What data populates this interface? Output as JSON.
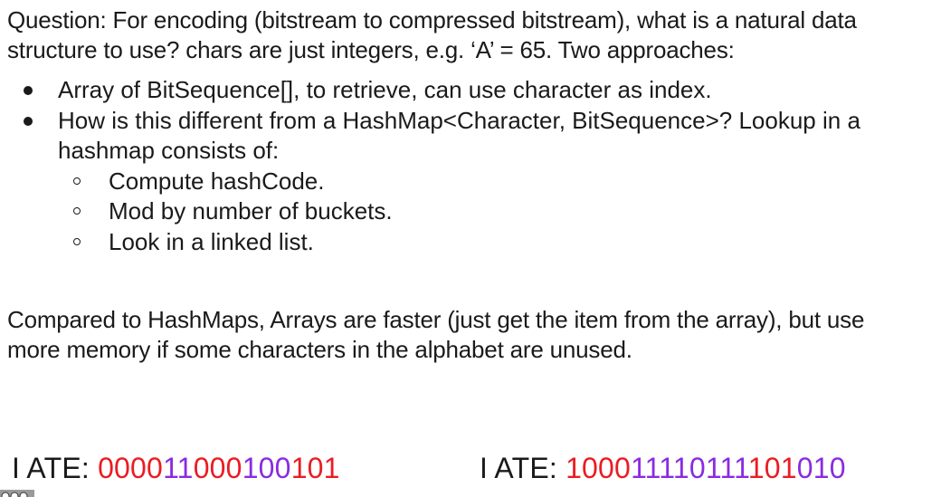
{
  "question_text": "Question: For encoding (bitstream to compressed bitstream), what is a natural data structure to use?  chars are just integers, e.g. ‘A’ = 65. Two approaches:",
  "bullets": [
    {
      "text": "Array of BitSequence[], to retrieve, can use character as index."
    },
    {
      "text": "How is this different from a HashMap<Character, BitSequence>? Lookup in a hashmap consists of:",
      "sub": [
        "Compute hashCode.",
        "Mod by number of buckets.",
        "Look in a linked list."
      ]
    }
  ],
  "comparison_text": "Compared to HashMaps, Arrays are faster (just get the item from the array), but use more memory if some characters in the alphabet are unused.",
  "encodings": [
    {
      "label": "I ATE: ",
      "segments": [
        {
          "text": "0000",
          "color": "#ea1c24"
        },
        {
          "text": "11",
          "color": "#8a2be2"
        },
        {
          "text": "000",
          "color": "#ea1c24"
        },
        {
          "text": "100",
          "color": "#8a2be2"
        },
        {
          "text": "101",
          "color": "#ea1c24"
        }
      ]
    },
    {
      "label": "I ATE: ",
      "segments": [
        {
          "text": "1000",
          "color": "#ea1c24"
        },
        {
          "text": "11110111",
          "color": "#8a2be2"
        },
        {
          "text": "101",
          "color": "#ea1c24"
        },
        {
          "text": "010",
          "color": "#8a2be2"
        }
      ]
    }
  ],
  "colors": {
    "text": "#1a1a1a",
    "red": "#ea1c24",
    "purple": "#8a2be2"
  }
}
